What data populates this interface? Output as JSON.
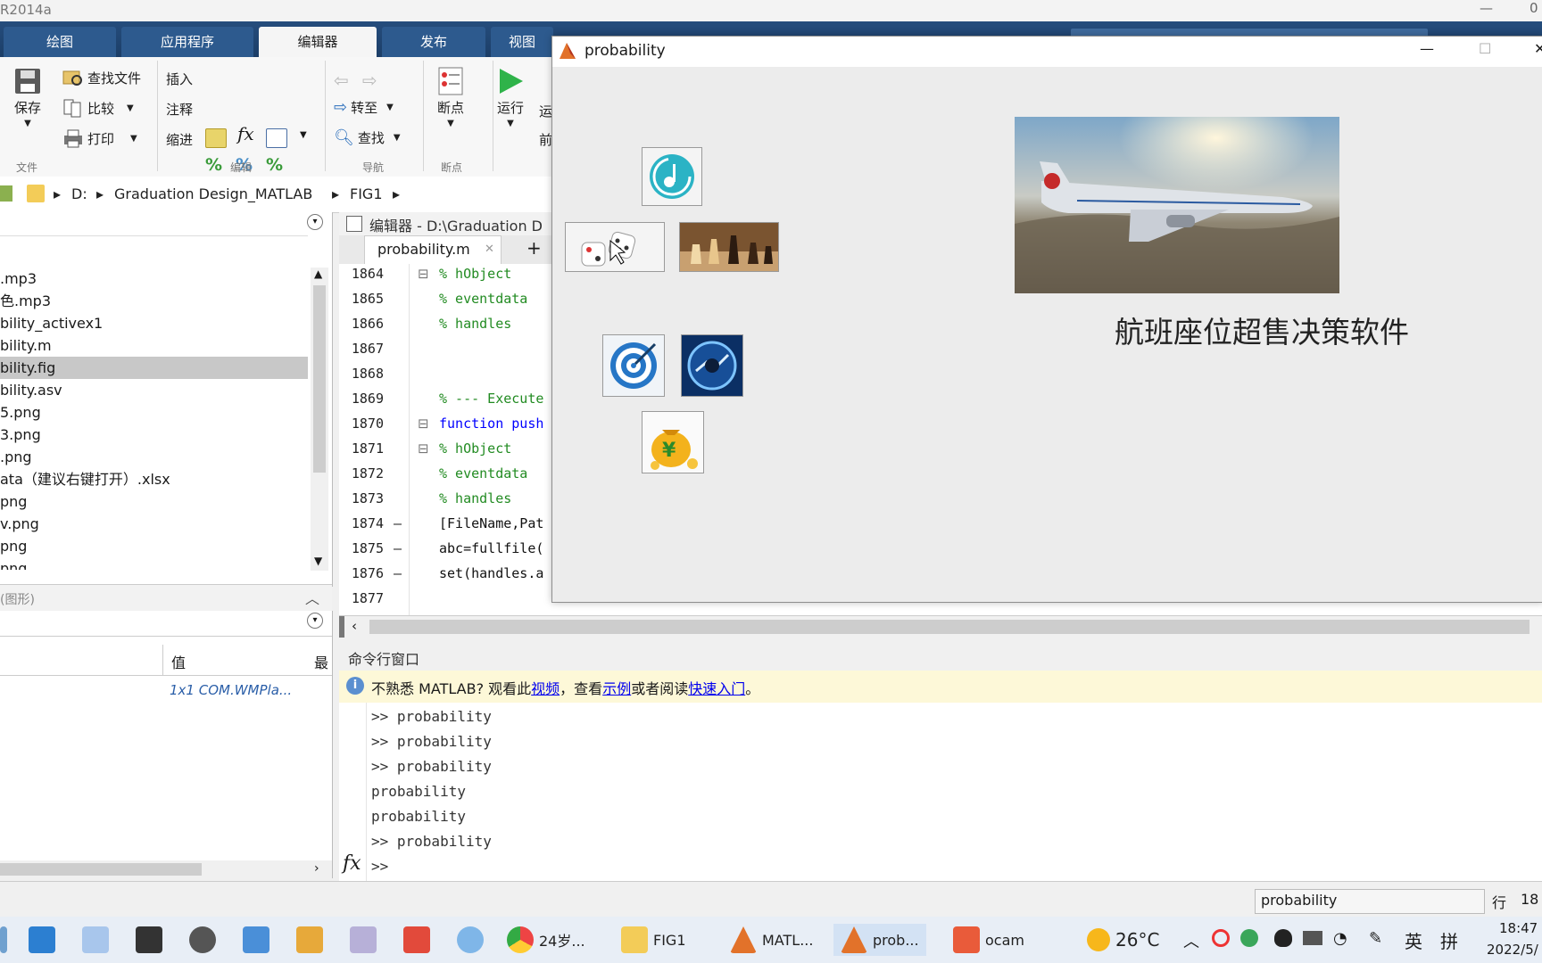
{
  "window": {
    "title": "R2014a",
    "title_right": "0"
  },
  "ribbon": {
    "tabs": [
      "绘图",
      "应用程序",
      "编辑器",
      "发布",
      "视图"
    ],
    "active_tab": "编辑器",
    "file_group": {
      "label": "文件",
      "save": "保存",
      "find_files": "查找文件",
      "compare": "比较",
      "print": "打印"
    },
    "edit_group": {
      "label": "编辑",
      "insert": "插入",
      "comment": "注释",
      "indent": "缩进",
      "fx": "fx"
    },
    "nav_group": {
      "label": "导航",
      "goto": "转至",
      "find": "查找"
    },
    "breakpoint_group": {
      "label": "断点",
      "breakpoints": "断点"
    },
    "run_group": {
      "run": "运行",
      "run_advance": "运",
      "run_section": "前"
    }
  },
  "address": {
    "drive": "D:",
    "folder1": "Graduation Design_MATLAB",
    "folder2": "FIG1"
  },
  "files": [
    {
      "name": ".mp3"
    },
    {
      "name": "色.mp3"
    },
    {
      "name": "bility_activex1"
    },
    {
      "name": "bility.m"
    },
    {
      "name": "bility.fig",
      "selected": true
    },
    {
      "name": "bility.asv"
    },
    {
      "name": "5.png"
    },
    {
      "name": "3.png"
    },
    {
      "name": ".png"
    },
    {
      "name": "ata（建议右键打开）.xlsx"
    },
    {
      "name": "png"
    },
    {
      "name": "v.png"
    },
    {
      "name": "png"
    },
    {
      "name": "png"
    }
  ],
  "details": {
    "label": "(图形)"
  },
  "workspace": {
    "col_value": "值",
    "col_max": "最",
    "row_value": "1x1 COM.WMPla..."
  },
  "editor": {
    "header": "编辑器 - D:\\Graduation D",
    "tab": "probability.m",
    "tab_close": "✕",
    "tab_add": "+",
    "lines": [
      {
        "n": "1864",
        "m": "",
        "text": "% hObject",
        "kind": "comment"
      },
      {
        "n": "1865",
        "m": "",
        "text": "% eventdata",
        "kind": "comment"
      },
      {
        "n": "1866",
        "m": "",
        "text": "% handles",
        "kind": "comment"
      },
      {
        "n": "1867",
        "m": "",
        "text": "",
        "kind": "code"
      },
      {
        "n": "1868",
        "m": "",
        "text": "",
        "kind": "code"
      },
      {
        "n": "1869",
        "m": "",
        "text": "% --- Execute",
        "kind": "comment"
      },
      {
        "n": "1870",
        "m": "",
        "text": "function push",
        "kind": "keyword"
      },
      {
        "n": "1871",
        "m": "",
        "text": "% hObject",
        "kind": "comment"
      },
      {
        "n": "1872",
        "m": "",
        "text": "% eventdata",
        "kind": "comment"
      },
      {
        "n": "1873",
        "m": "",
        "text": "% handles",
        "kind": "comment"
      },
      {
        "n": "1874",
        "m": "–",
        "text": "[FileName,Pat",
        "kind": "code"
      },
      {
        "n": "1875",
        "m": "–",
        "text": "abc=fullfile(",
        "kind": "code"
      },
      {
        "n": "1876",
        "m": "–",
        "text": "set(handles.a",
        "kind": "code"
      },
      {
        "n": "1877",
        "m": "",
        "text": "",
        "kind": "code"
      }
    ]
  },
  "command": {
    "title": "命令行窗口",
    "info_prefix": "不熟悉 MATLAB? 观看此",
    "info_link1": "视频",
    "info_mid1": "，查看",
    "info_link2": "示例",
    "info_mid2": "或者阅读",
    "info_link3": "快速入门",
    "info_suffix": "。",
    "lines": [
      ">> probability",
      ">> probability",
      ">> probability",
      "probability",
      "probability",
      ">> probability"
    ],
    "prompt": ">>",
    "fx": "fx"
  },
  "status": {
    "current": "probability",
    "row_label": "行",
    "row_value": "18"
  },
  "figure": {
    "title": "probability",
    "app_title": "航班座位超售决策软件",
    "min": "—",
    "max": "☐",
    "close": "✕"
  },
  "taskbar": {
    "chrome": "24岁...",
    "folder": "FIG1",
    "matlab": "MATL...",
    "prob": "prob...",
    "ocam": "ocam",
    "weather": "26°C",
    "lang": "英",
    "ime": "拼",
    "time": "18:47",
    "date": "2022/5/"
  },
  "colors": {
    "ribbon_blue": "#1f426c",
    "link": "#0000ee",
    "comment": "#228b22",
    "keyword": "#0000ff"
  }
}
